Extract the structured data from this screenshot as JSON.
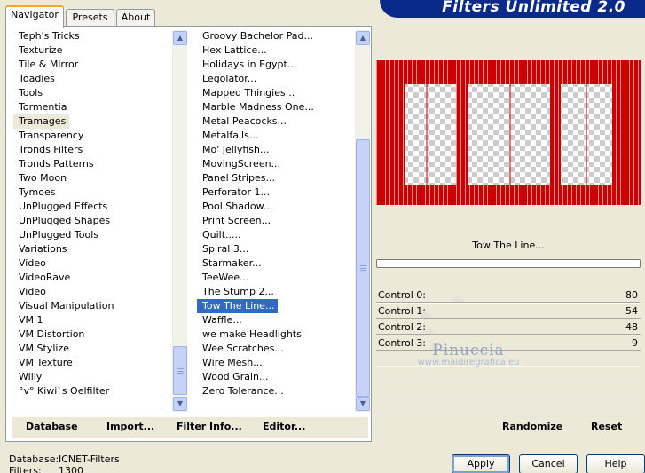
{
  "banner": {
    "title": "Filters Unlimited 2.0"
  },
  "tabs": [
    {
      "label": "Navigator",
      "active": true
    },
    {
      "label": "Presets",
      "active": false
    },
    {
      "label": "About",
      "active": false
    }
  ],
  "categories": [
    "Teph's Tricks",
    "Texturize",
    "Tile & Mirror",
    "Toadies",
    "Tools",
    "Tormentia",
    "Tramages",
    "Transparency",
    "Tronds Filters",
    "Tronds Patterns",
    "Two Moon",
    "Tymoes",
    "UnPlugged Effects",
    "UnPlugged Shapes",
    "UnPlugged Tools",
    "Variations",
    "Video",
    "VideoRave",
    "Video",
    "Visual Manipulation",
    "VM 1",
    "VM Distortion",
    "VM Stylize",
    "VM Texture",
    "Willy",
    "°v° Kiwi`s Oelfilter"
  ],
  "selected_category": "Tramages",
  "filters": [
    "Groovy Bachelor Pad...",
    "Hex Lattice...",
    "Holidays in Egypt...",
    "Legolator...",
    "Mapped Thingies...",
    "Marble Madness One...",
    "Metal Peacocks...",
    "Metalfalls...",
    "Mo' Jellyfish...",
    "MovingScreen...",
    "Panel Stripes...",
    "Perforator 1...",
    "Pool Shadow...",
    "Print Screen...",
    "Quilt.....",
    "Spiral 3...",
    "Starmaker...",
    "TeeWee...",
    "The Stump 2...",
    "Tow The Line...",
    "Waffle...",
    "we make Headlights",
    "Wee Scratches...",
    "Wire Mesh...",
    "Wood Grain...",
    "Zero Tolerance..."
  ],
  "selected_filter": "Tow The Line...",
  "bottom_buttons": {
    "database": "Database",
    "import": "Import...",
    "filter_info": "Filter Info...",
    "editor": "Editor..."
  },
  "preview": {
    "stripe_color": "#cc0000"
  },
  "filter_title": "Tow The Line...",
  "progress": 0,
  "controls": [
    {
      "label": "Control 0:",
      "value": "80"
    },
    {
      "label": "Control 1:",
      "value": "54"
    },
    {
      "label": "Control 2:",
      "value": "48"
    },
    {
      "label": "Control 3:",
      "value": "9"
    }
  ],
  "watermark": {
    "name": "Pinuccia",
    "site": "www.maidiregrafica.eu"
  },
  "right_buttons": {
    "randomize": "Randomize",
    "reset": "Reset"
  },
  "footer": {
    "database_label": "Database:",
    "database_value": "ICNET-Filters",
    "filters_label": "Filters:",
    "filters_value": "1300"
  },
  "dialog_buttons": {
    "apply": "Apply",
    "cancel": "Cancel",
    "help": "Help"
  }
}
